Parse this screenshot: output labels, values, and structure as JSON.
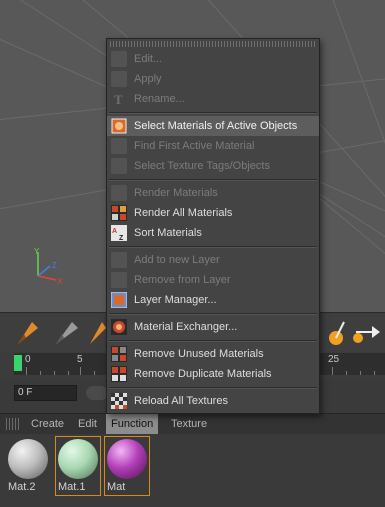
{
  "menu": {
    "items": [
      {
        "label": "Edit...",
        "enabled": false,
        "icon": "edit-icon"
      },
      {
        "label": "Apply",
        "enabled": false,
        "icon": "apply-icon"
      },
      {
        "label": "Rename...",
        "enabled": false,
        "icon": "rename-icon"
      },
      {
        "label": "Select Materials of Active Objects",
        "enabled": true,
        "icon": "select-materials-icon"
      },
      {
        "label": "Find First Active Material",
        "enabled": false,
        "icon": "find-material-icon"
      },
      {
        "label": "Select Texture Tags/Objects",
        "enabled": false,
        "icon": "select-texture-tags-icon"
      },
      {
        "label": "Render Materials",
        "enabled": false,
        "icon": "render-materials-icon"
      },
      {
        "label": "Render All Materials",
        "enabled": true,
        "icon": "render-all-materials-icon"
      },
      {
        "label": "Sort Materials",
        "enabled": true,
        "icon": "sort-materials-icon"
      },
      {
        "label": "Add to new Layer",
        "enabled": false,
        "icon": "add-layer-icon"
      },
      {
        "label": "Remove from Layer",
        "enabled": false,
        "icon": "remove-layer-icon"
      },
      {
        "label": "Layer Manager...",
        "enabled": true,
        "icon": "layer-manager-icon"
      },
      {
        "label": "Material Exchanger...",
        "enabled": true,
        "icon": "material-exchanger-icon"
      },
      {
        "label": "Remove Unused Materials",
        "enabled": true,
        "icon": "remove-unused-icon"
      },
      {
        "label": "Remove Duplicate Materials",
        "enabled": true,
        "icon": "remove-duplicate-icon"
      },
      {
        "label": "Reload All Textures",
        "enabled": true,
        "icon": "reload-textures-icon"
      }
    ]
  },
  "timeline": {
    "tick_labels": [
      "0",
      "5",
      "25"
    ],
    "frame_value": "0 F"
  },
  "material_manager": {
    "tabs": [
      "Create",
      "Edit",
      "Function",
      "Texture"
    ],
    "active_tab": "Function",
    "materials": [
      {
        "name": "Mat.2",
        "color": "#bdbdbd"
      },
      {
        "name": "Mat.1",
        "color": "#a9d8b2"
      },
      {
        "name": "Mat",
        "color": "#b23fb8"
      }
    ]
  },
  "colors": {
    "accent_selection": "#d58a1f",
    "playhead": "#3bd46a"
  }
}
